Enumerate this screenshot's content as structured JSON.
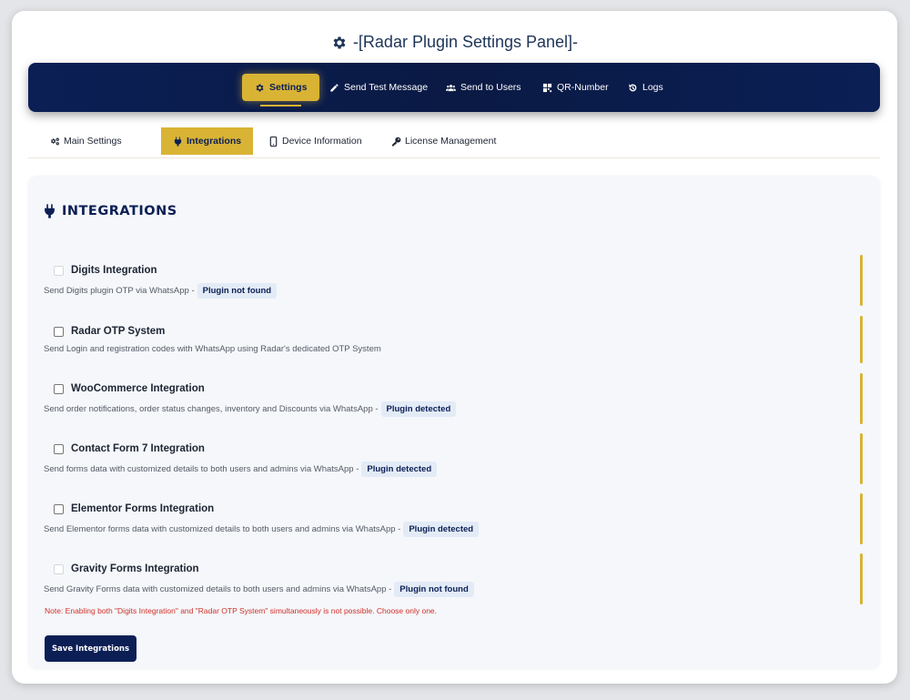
{
  "page_title": "-[Radar Plugin Settings Panel]-",
  "nav": [
    {
      "label": "Settings",
      "icon": "gear-icon",
      "active": true
    },
    {
      "label": "Send Test Message",
      "icon": "pencil-icon",
      "active": false
    },
    {
      "label": "Send to Users",
      "icon": "users-icon",
      "active": false
    },
    {
      "label": "QR-Number",
      "icon": "qr-icon",
      "active": false
    },
    {
      "label": "Logs",
      "icon": "history-icon",
      "active": false
    }
  ],
  "tabs": [
    {
      "label": "Main Settings",
      "icon": "gears-icon",
      "active": false
    },
    {
      "label": "Integrations",
      "icon": "plug-icon",
      "active": true
    },
    {
      "label": "Device Information",
      "icon": "mobile-icon",
      "active": false
    },
    {
      "label": "License Management",
      "icon": "key-icon",
      "active": false
    }
  ],
  "section_title": "INTEGRATIONS",
  "integrations": [
    {
      "name": "Digits Integration",
      "description": "Send Digits plugin OTP via WhatsApp -",
      "badge": "Plugin not found",
      "checked": false,
      "disabled": true
    },
    {
      "name": "Radar OTP System",
      "description": "Send Login and registration codes with WhatsApp using Radar's dedicated OTP System",
      "badge": "",
      "checked": false,
      "disabled": false
    },
    {
      "name": "WooCommerce Integration",
      "description": "Send order notifications, order status changes, inventory and Discounts via WhatsApp -",
      "badge": "Plugin detected",
      "checked": false,
      "disabled": false
    },
    {
      "name": "Contact Form 7 Integration",
      "description": "Send forms data with customized details to both users and admins via WhatsApp -",
      "badge": "Plugin detected",
      "checked": false,
      "disabled": false
    },
    {
      "name": "Elementor Forms Integration",
      "description": "Send Elementor forms data with customized details to both users and admins via WhatsApp -",
      "badge": "Plugin detected",
      "checked": false,
      "disabled": false
    },
    {
      "name": "Gravity Forms Integration",
      "description": "Send Gravity Forms data with customized details to both users and admins via WhatsApp -",
      "badge": "Plugin not found",
      "checked": false,
      "disabled": true
    }
  ],
  "note": "Note: Enabling both \"Digits Integration\" and \"Radar OTP System\" simultaneously is not possible. Choose only one.",
  "save_label": "Save Integrations",
  "colors": {
    "accent": "#d9b334",
    "navy": "#0b1f55",
    "note": "#d0302a"
  }
}
